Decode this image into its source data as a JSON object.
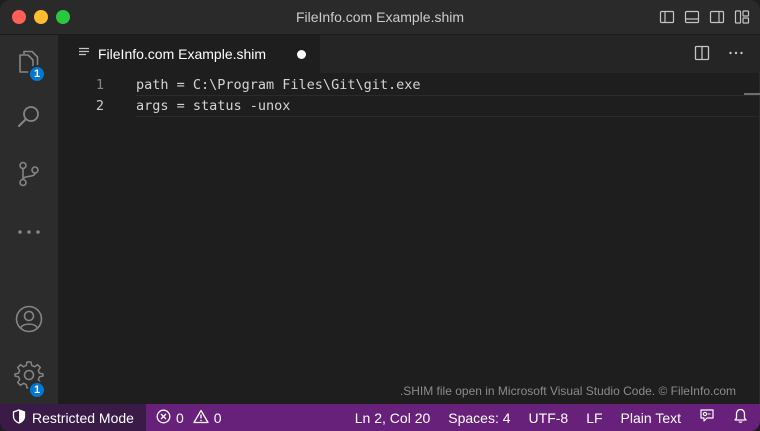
{
  "window": {
    "title": "FileInfo.com Example.shim"
  },
  "activity_bar": {
    "explorer_badge": "1",
    "settings_badge": "1"
  },
  "tabs": [
    {
      "label": "FileInfo.com Example.shim",
      "dirty": true
    }
  ],
  "editor": {
    "lines": [
      {
        "number": "1",
        "text": "path = C:\\Program Files\\Git\\git.exe"
      },
      {
        "number": "2",
        "text": "args = status -unox"
      }
    ],
    "footer_note": ".SHIM file open in Microsoft Visual Studio Code. © FileInfo.com"
  },
  "status_bar": {
    "restricted_mode": "Restricted Mode",
    "errors": "0",
    "warnings": "0",
    "cursor_position": "Ln 2, Col 20",
    "indentation": "Spaces: 4",
    "encoding": "UTF-8",
    "line_ending": "LF",
    "language": "Plain Text",
    "colors": {
      "background": "#68217a",
      "restricted_background": "#3a1a46"
    }
  },
  "icons": {
    "activity": [
      "files-icon",
      "search-icon",
      "source-control-icon",
      "more-icon",
      "account-icon",
      "gear-icon"
    ],
    "title_bar": [
      "toggle-primary-sidebar-icon",
      "toggle-panel-icon",
      "toggle-secondary-sidebar-icon",
      "customize-layout-icon"
    ],
    "tab_actions": [
      "split-editor-icon",
      "more-actions-icon"
    ]
  }
}
